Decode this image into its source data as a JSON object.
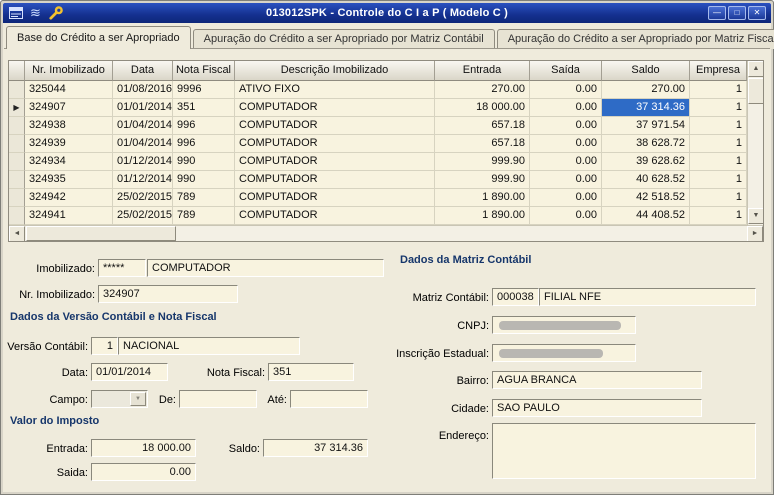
{
  "window": {
    "title": "013012SPK - Controle do C I a P  ( Modelo C )"
  },
  "icons": {
    "minimize": "—",
    "maximize": "□",
    "close": "✕",
    "scroll_up": "▲",
    "scroll_down": "▼",
    "scroll_left": "◄",
    "scroll_right": "►",
    "row_pointer": "▶",
    "dropdown": "▼",
    "logo_waves": "≋"
  },
  "tabs": [
    {
      "label": "Base do Crédito a ser Apropriado"
    },
    {
      "label": "Apuração do Crédito a ser Apropriado por Matriz Contábil"
    },
    {
      "label": "Apuração do Crédito a ser Apropriado por Matriz Fiscal"
    }
  ],
  "grid": {
    "columns": [
      "Nr. Imobilizado",
      "Data",
      "Nota Fiscal",
      "Descrição Imobilizado",
      "Entrada",
      "Saída",
      "Saldo",
      "Empresa"
    ],
    "rows": [
      [
        "325044",
        "01/08/2016",
        "9996",
        "ATIVO FIXO",
        "270.00",
        "0.00",
        "270.00",
        "1"
      ],
      [
        "324907",
        "01/01/2014",
        "351",
        "COMPUTADOR",
        "18 000.00",
        "0.00",
        "37 314.36",
        "1"
      ],
      [
        "324938",
        "01/04/2014",
        "996",
        "COMPUTADOR",
        "657.18",
        "0.00",
        "37 971.54",
        "1"
      ],
      [
        "324939",
        "01/04/2014",
        "996",
        "COMPUTADOR",
        "657.18",
        "0.00",
        "38 628.72",
        "1"
      ],
      [
        "324934",
        "01/12/2014",
        "990",
        "COMPUTADOR",
        "999.90",
        "0.00",
        "39 628.62",
        "1"
      ],
      [
        "324935",
        "01/12/2014",
        "990",
        "COMPUTADOR",
        "999.90",
        "0.00",
        "40 628.52",
        "1"
      ],
      [
        "324942",
        "25/02/2015",
        "789",
        "COMPUTADOR",
        "1 890.00",
        "0.00",
        "42 518.52",
        "1"
      ],
      [
        "324941",
        "25/02/2015",
        "789",
        "COMPUTADOR",
        "1 890.00",
        "0.00",
        "44 408.52",
        "1"
      ]
    ],
    "selected": {
      "row": 1,
      "col": 6
    }
  },
  "sections": {
    "versao": "Dados da Versão Contábil e Nota Fiscal",
    "valor": "Valor do Imposto",
    "matriz": "Dados da Matriz Contábil"
  },
  "form": {
    "imobilizado": {
      "label": "Imobilizado:",
      "code": "*****",
      "desc": "COMPUTADOR"
    },
    "nr_imobilizado": {
      "label": "Nr. Imobilizado:",
      "value": "324907"
    },
    "versao_contabil": {
      "label": "Versão Contábil:",
      "code": "1",
      "desc": "NACIONAL"
    },
    "data": {
      "label": "Data:",
      "value": "01/01/2014"
    },
    "nota_fiscal": {
      "label": "Nota Fiscal:",
      "value": "351"
    },
    "campo": {
      "label": "Campo:",
      "value": ""
    },
    "de": {
      "label": "De:",
      "value": ""
    },
    "ate": {
      "label": "Até:",
      "value": ""
    },
    "entrada": {
      "label": "Entrada:",
      "value": "18 000.00"
    },
    "saldo": {
      "label": "Saldo:",
      "value": "37 314.36"
    },
    "saida": {
      "label": "Saida:",
      "value": "0.00"
    },
    "matriz_contabil": {
      "label": "Matriz Contábil:",
      "code": "000038",
      "desc": "FILIAL NFE"
    },
    "cnpj": {
      "label": "CNPJ:",
      "value": ""
    },
    "inscricao": {
      "label": "Inscrição Estadual:",
      "value": ""
    },
    "bairro": {
      "label": "Bairro:",
      "value": "AGUA BRANCA"
    },
    "cidade": {
      "label": "Cidade:",
      "value": "SAO PAULO"
    },
    "endereco": {
      "label": "Endereço:",
      "value": ""
    }
  }
}
